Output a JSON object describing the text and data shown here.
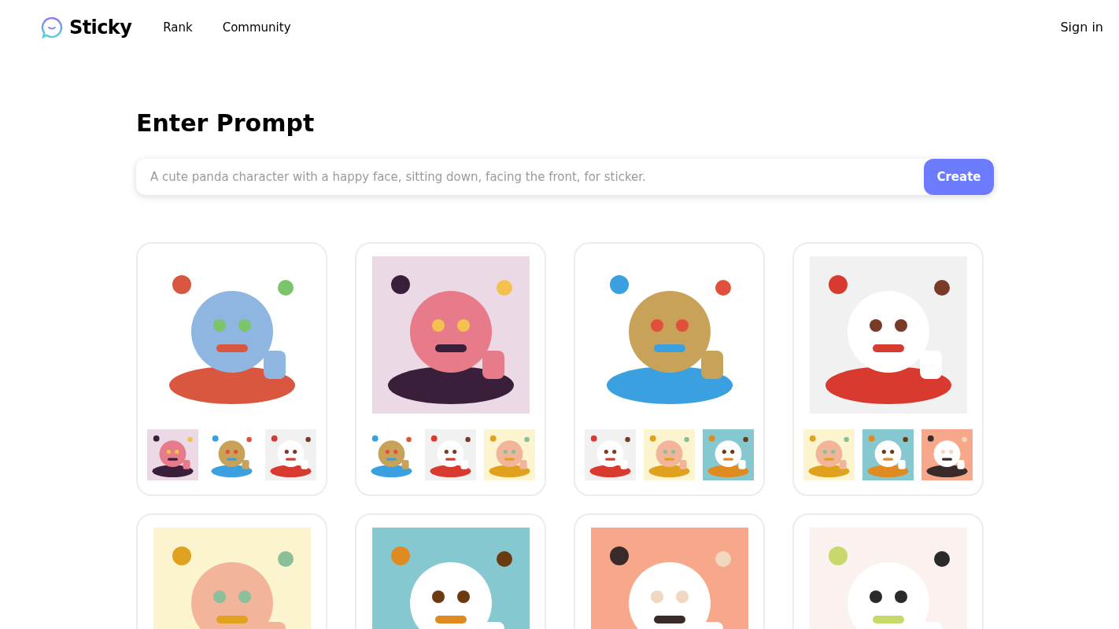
{
  "header": {
    "brand": "Sticky",
    "nav": [
      {
        "label": "Rank"
      },
      {
        "label": "Community"
      }
    ],
    "sign_in": "Sign in"
  },
  "prompt": {
    "title": "Enter Prompt",
    "placeholder": "A cute panda character with a happy face, sitting down, facing the front, for sticker.",
    "button": "Create"
  },
  "cards": [
    {
      "kind": "picture",
      "thumbnails": [
        {
          "kind": "picture"
        },
        {
          "kind": "picture"
        },
        {
          "kind": "picture"
        }
      ]
    },
    {
      "kind": "picture",
      "thumbnails": [
        {
          "kind": "picture"
        },
        {
          "kind": "picture"
        },
        {
          "kind": "picture"
        }
      ]
    },
    {
      "kind": "picture",
      "thumbnails": [
        {
          "kind": "picture"
        },
        {
          "kind": "picture"
        },
        {
          "kind": "picture"
        }
      ]
    },
    {
      "kind": "picture",
      "thumbnails": [
        {
          "kind": "picture"
        },
        {
          "kind": "picture"
        },
        {
          "kind": "picture"
        }
      ]
    },
    {
      "kind": "picture"
    },
    {
      "kind": "picture"
    },
    {
      "kind": "picture"
    },
    {
      "kind": "picture"
    }
  ]
}
